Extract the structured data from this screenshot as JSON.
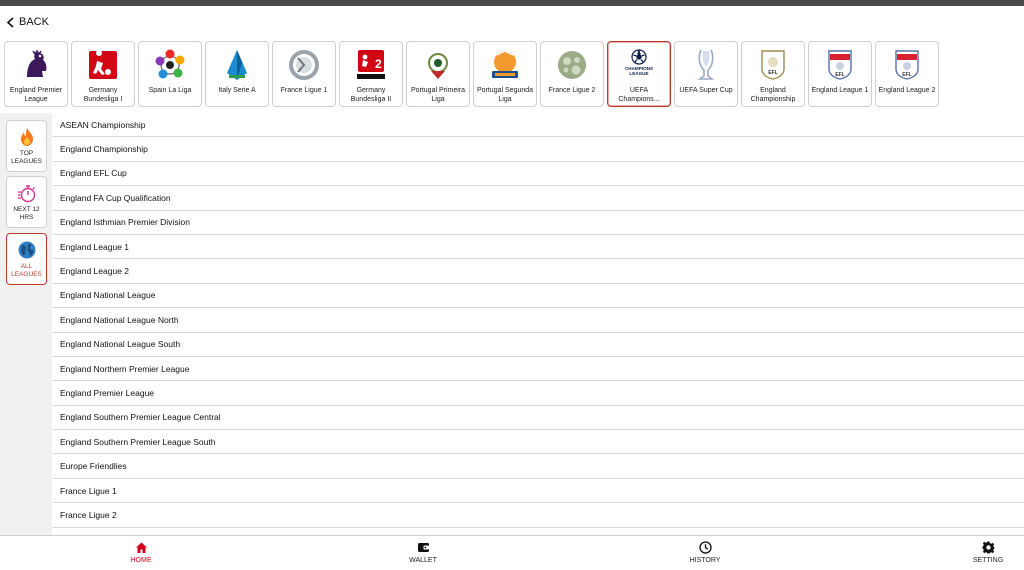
{
  "header": {
    "back_label": "BACK"
  },
  "leagues": [
    {
      "name": "England Premier League",
      "icon": "premier-league-logo"
    },
    {
      "name": "Germany Bundesliga I",
      "icon": "bundesliga-logo"
    },
    {
      "name": "Spain La Liga",
      "icon": "laliga-logo"
    },
    {
      "name": "Italy Serie A",
      "icon": "serie-a-logo"
    },
    {
      "name": "France Ligue 1",
      "icon": "ligue1-logo"
    },
    {
      "name": "Germany Bundesliga II",
      "icon": "bundesliga2-logo"
    },
    {
      "name": "Portugal Primeira Liga",
      "icon": "primeira-liga-logo"
    },
    {
      "name": "Portugal Segunda Liga",
      "icon": "segunda-liga-logo"
    },
    {
      "name": "France Ligue 2",
      "icon": "ligue2-logo"
    },
    {
      "name": "UEFA Champions...",
      "icon": "champions-league-logo",
      "active": true
    },
    {
      "name": "UEFA Super Cup",
      "icon": "super-cup-logo"
    },
    {
      "name": "England Championship",
      "icon": "efl-championship-logo"
    },
    {
      "name": "England League 1",
      "icon": "efl-league1-logo"
    },
    {
      "name": "England League 2",
      "icon": "efl-league2-logo"
    }
  ],
  "sidebar": {
    "top": {
      "label": "TOP LEAGUES",
      "icon": "fire-icon"
    },
    "next": {
      "label": "NEXT 12 HRS",
      "icon": "stopwatch-icon"
    },
    "all": {
      "label": "ALL LEAGUES",
      "icon": "globe-icon"
    }
  },
  "all_leagues": [
    "ASEAN Championship",
    "England Championship",
    "England EFL Cup",
    "England FA Cup Qualification",
    "England Isthmian Premier Division",
    "England League 1",
    "England League 2",
    "England National League",
    "England National League North",
    "England National League South",
    "England Northern Premier League",
    "England Premier League",
    "England Southern Premier League Central",
    "England Southern Premier League South",
    "Europe Friendlies",
    "France Ligue 1",
    "France Ligue 2"
  ],
  "nav": {
    "home": "HOME",
    "wallet": "WALLET",
    "history": "HISTORY",
    "setting": "SETTING"
  },
  "colors": {
    "accent": "#d0021b",
    "active_border": "#c0392b",
    "sidebar_bg": "#f1f1f1"
  }
}
